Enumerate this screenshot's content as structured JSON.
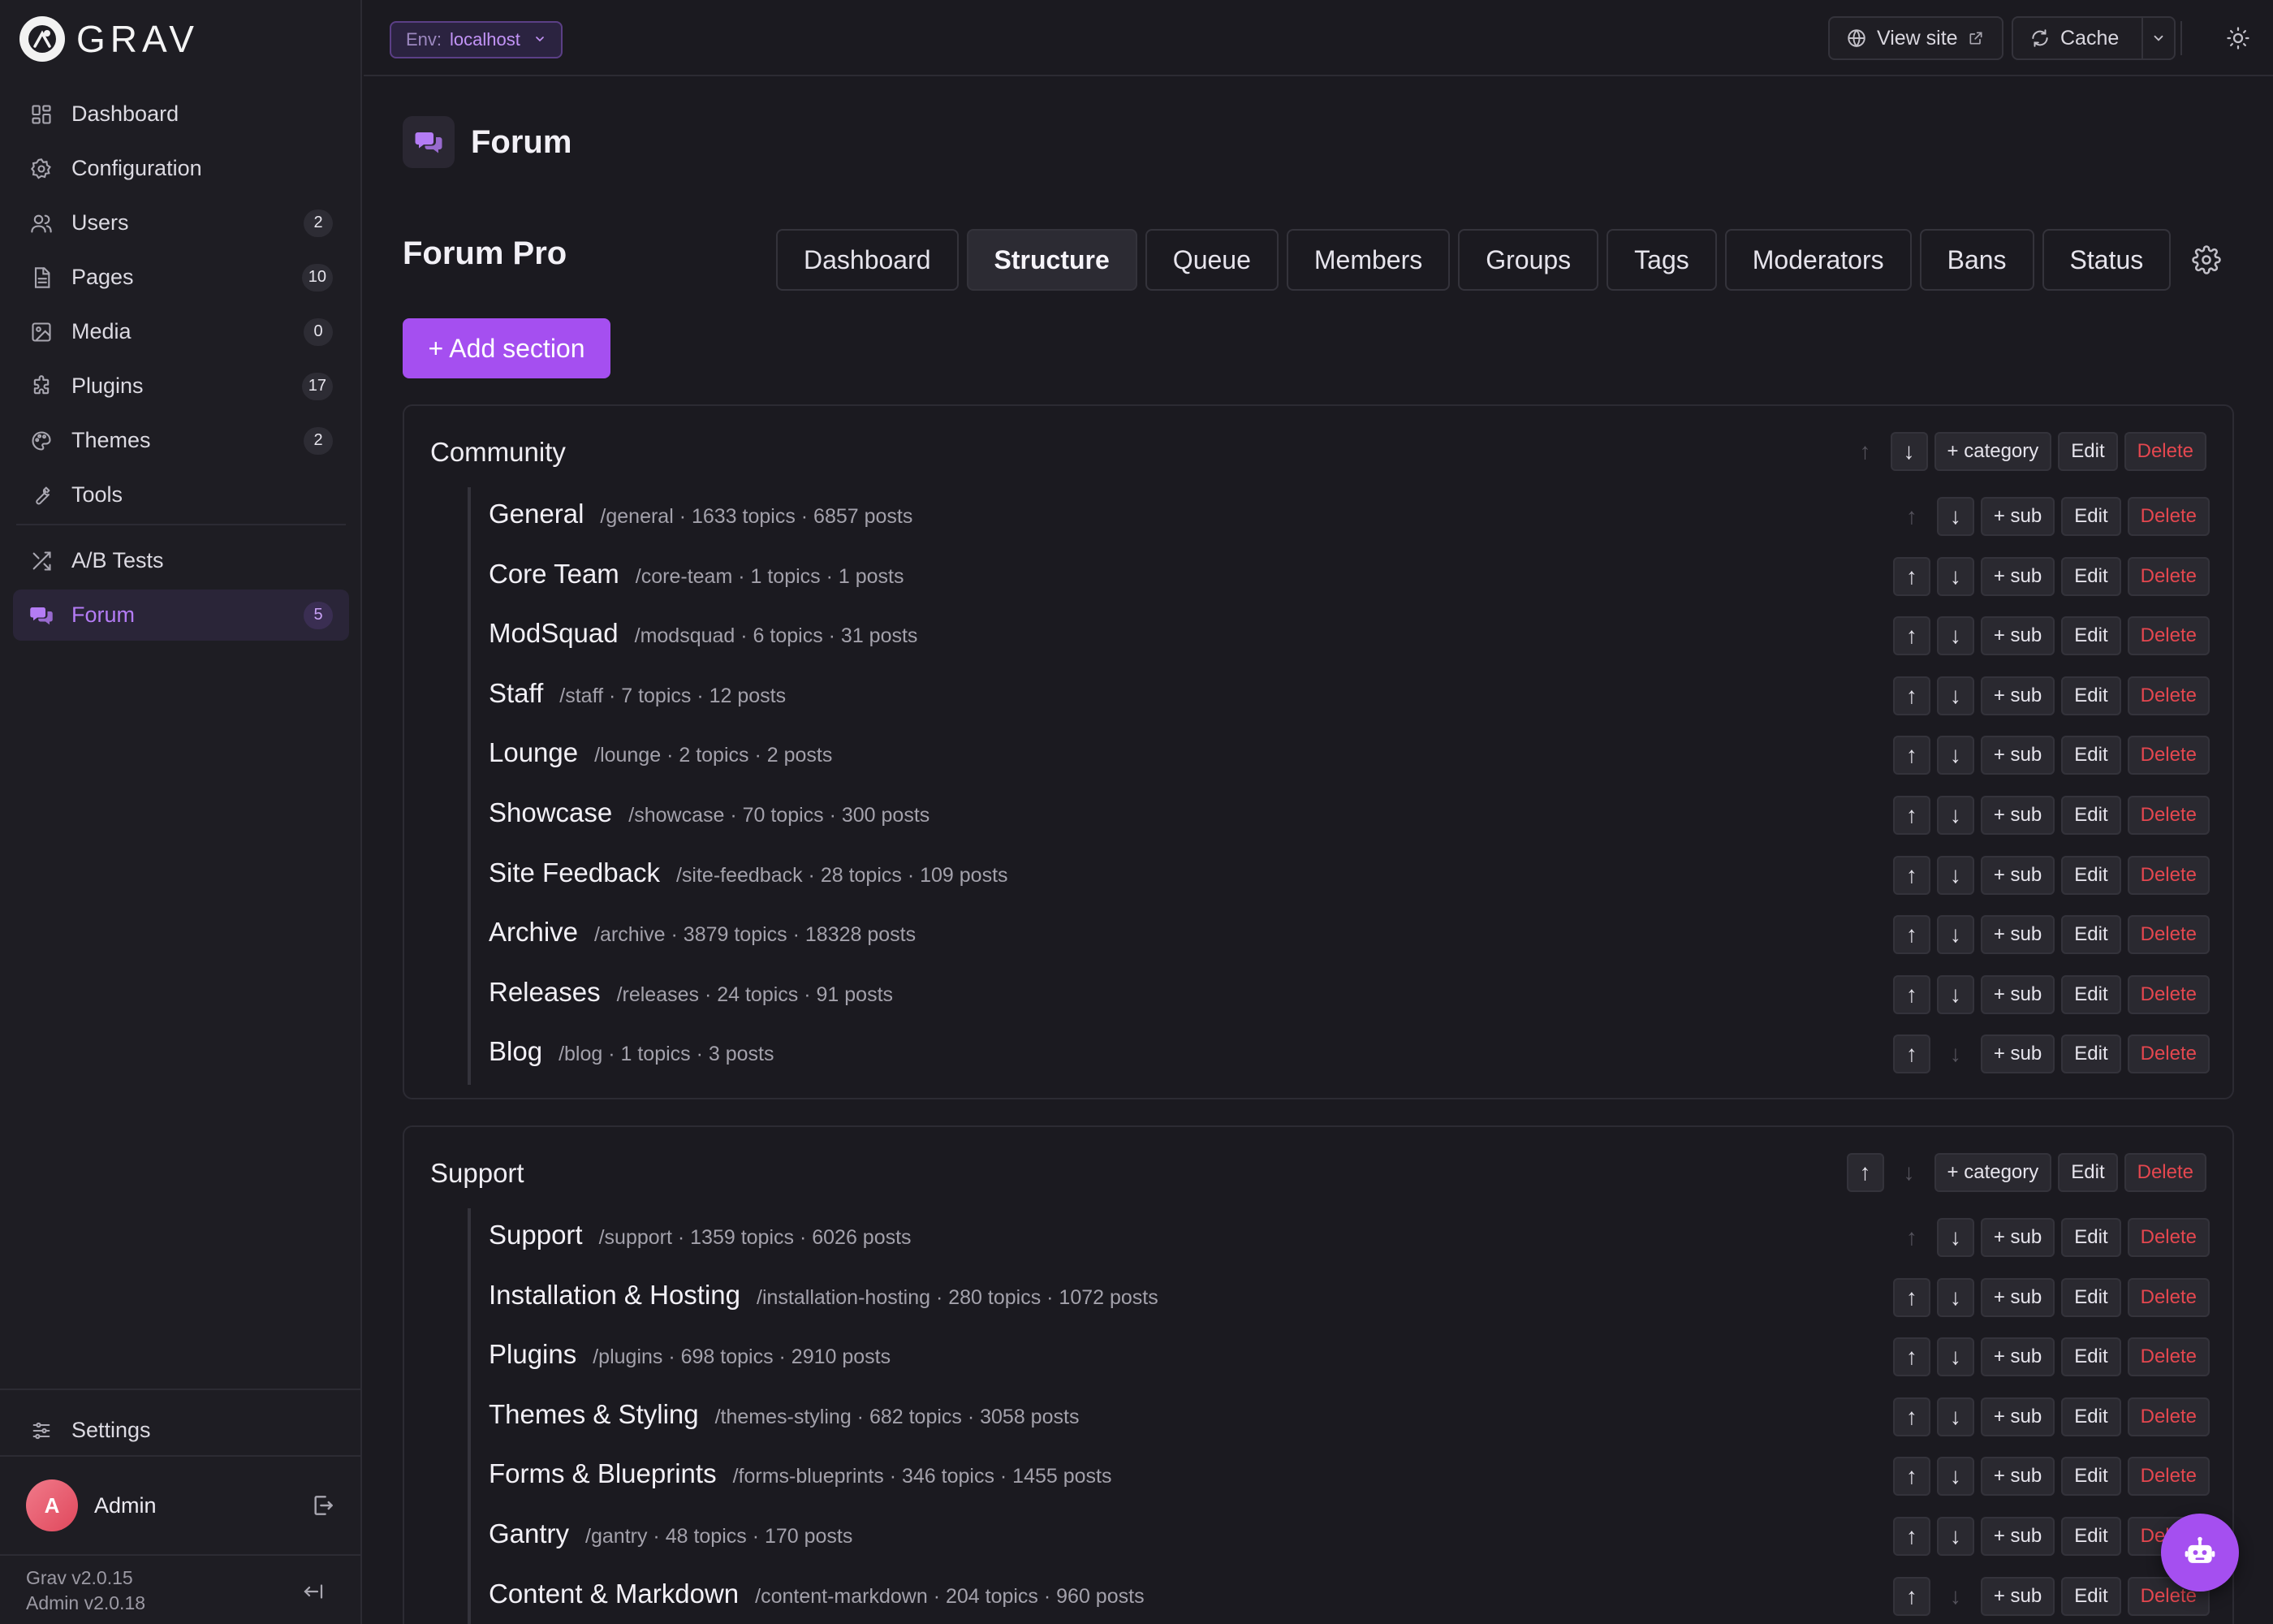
{
  "brand": {
    "name": "GRAV"
  },
  "sidebar": {
    "items": [
      {
        "label": "Dashboard",
        "icon": "dashboard-icon",
        "count": null
      },
      {
        "label": "Configuration",
        "icon": "gear-icon",
        "count": null
      },
      {
        "label": "Users",
        "icon": "users-icon",
        "count": "2"
      },
      {
        "label": "Pages",
        "icon": "page-icon",
        "count": "10"
      },
      {
        "label": "Media",
        "icon": "image-icon",
        "count": "0"
      },
      {
        "label": "Plugins",
        "icon": "puzzle-icon",
        "count": "17"
      },
      {
        "label": "Themes",
        "icon": "palette-icon",
        "count": "2"
      },
      {
        "label": "Tools",
        "icon": "wrench-icon",
        "count": null
      }
    ],
    "items2": [
      {
        "label": "A/B Tests",
        "icon": "shuffle-icon",
        "count": null
      },
      {
        "label": "Forum",
        "icon": "chat-bubbles-icon",
        "count": "5",
        "active": true
      }
    ],
    "settings_label": "Settings",
    "user_name": "Admin",
    "user_initial": "A",
    "version_grav": "Grav v2.0.15",
    "version_admin": "Admin v2.0.18"
  },
  "topbar": {
    "env_key": "Env:",
    "env_value": "localhost",
    "view_site": "View site",
    "cache": "Cache"
  },
  "page": {
    "title": "Forum"
  },
  "plugin": {
    "title": "Forum Pro",
    "tabs": [
      "Dashboard",
      "Structure",
      "Queue",
      "Members",
      "Groups",
      "Tags",
      "Moderators",
      "Bans",
      "Status"
    ],
    "active_tab": "Structure",
    "add_section_label": "+ Add section"
  },
  "labels": {
    "add_category": "+ category",
    "add_sub": "+ sub",
    "edit": "Edit",
    "delete": "Delete",
    "up": "↑",
    "down": "↓"
  },
  "sections": [
    {
      "title": "Community",
      "up_disabled": true,
      "down_disabled": false,
      "categories": [
        {
          "name": "General",
          "meta": "/general · 1633 topics · 6857 posts"
        },
        {
          "name": "Core Team",
          "meta": "/core-team · 1 topics · 1 posts"
        },
        {
          "name": "ModSquad",
          "meta": "/modsquad · 6 topics · 31 posts"
        },
        {
          "name": "Staff",
          "meta": "/staff · 7 topics · 12 posts"
        },
        {
          "name": "Lounge",
          "meta": "/lounge · 2 topics · 2 posts"
        },
        {
          "name": "Showcase",
          "meta": "/showcase · 70 topics · 300 posts"
        },
        {
          "name": "Site Feedback",
          "meta": "/site-feedback · 28 topics · 109 posts"
        },
        {
          "name": "Archive",
          "meta": "/archive · 3879 topics · 18328 posts"
        },
        {
          "name": "Releases",
          "meta": "/releases · 24 topics · 91 posts"
        },
        {
          "name": "Blog",
          "meta": "/blog · 1 topics · 3 posts"
        }
      ]
    },
    {
      "title": "Support",
      "up_disabled": false,
      "down_disabled": true,
      "categories": [
        {
          "name": "Support",
          "meta": "/support · 1359 topics · 6026 posts"
        },
        {
          "name": "Installation & Hosting",
          "meta": "/installation-hosting · 280 topics · 1072 posts"
        },
        {
          "name": "Plugins",
          "meta": "/plugins · 698 topics · 2910 posts"
        },
        {
          "name": "Themes & Styling",
          "meta": "/themes-styling · 682 topics · 3058 posts"
        },
        {
          "name": "Forms & Blueprints",
          "meta": "/forms-blueprints · 346 topics · 1455 posts"
        },
        {
          "name": "Gantry",
          "meta": "/gantry · 48 topics · 170 posts"
        },
        {
          "name": "Content & Markdown",
          "meta": "/content-markdown · 204 topics · 960 posts"
        }
      ]
    }
  ],
  "colors": {
    "accent": "#a54ff0",
    "danger": "#e4474f",
    "background": "#1b1a20"
  }
}
